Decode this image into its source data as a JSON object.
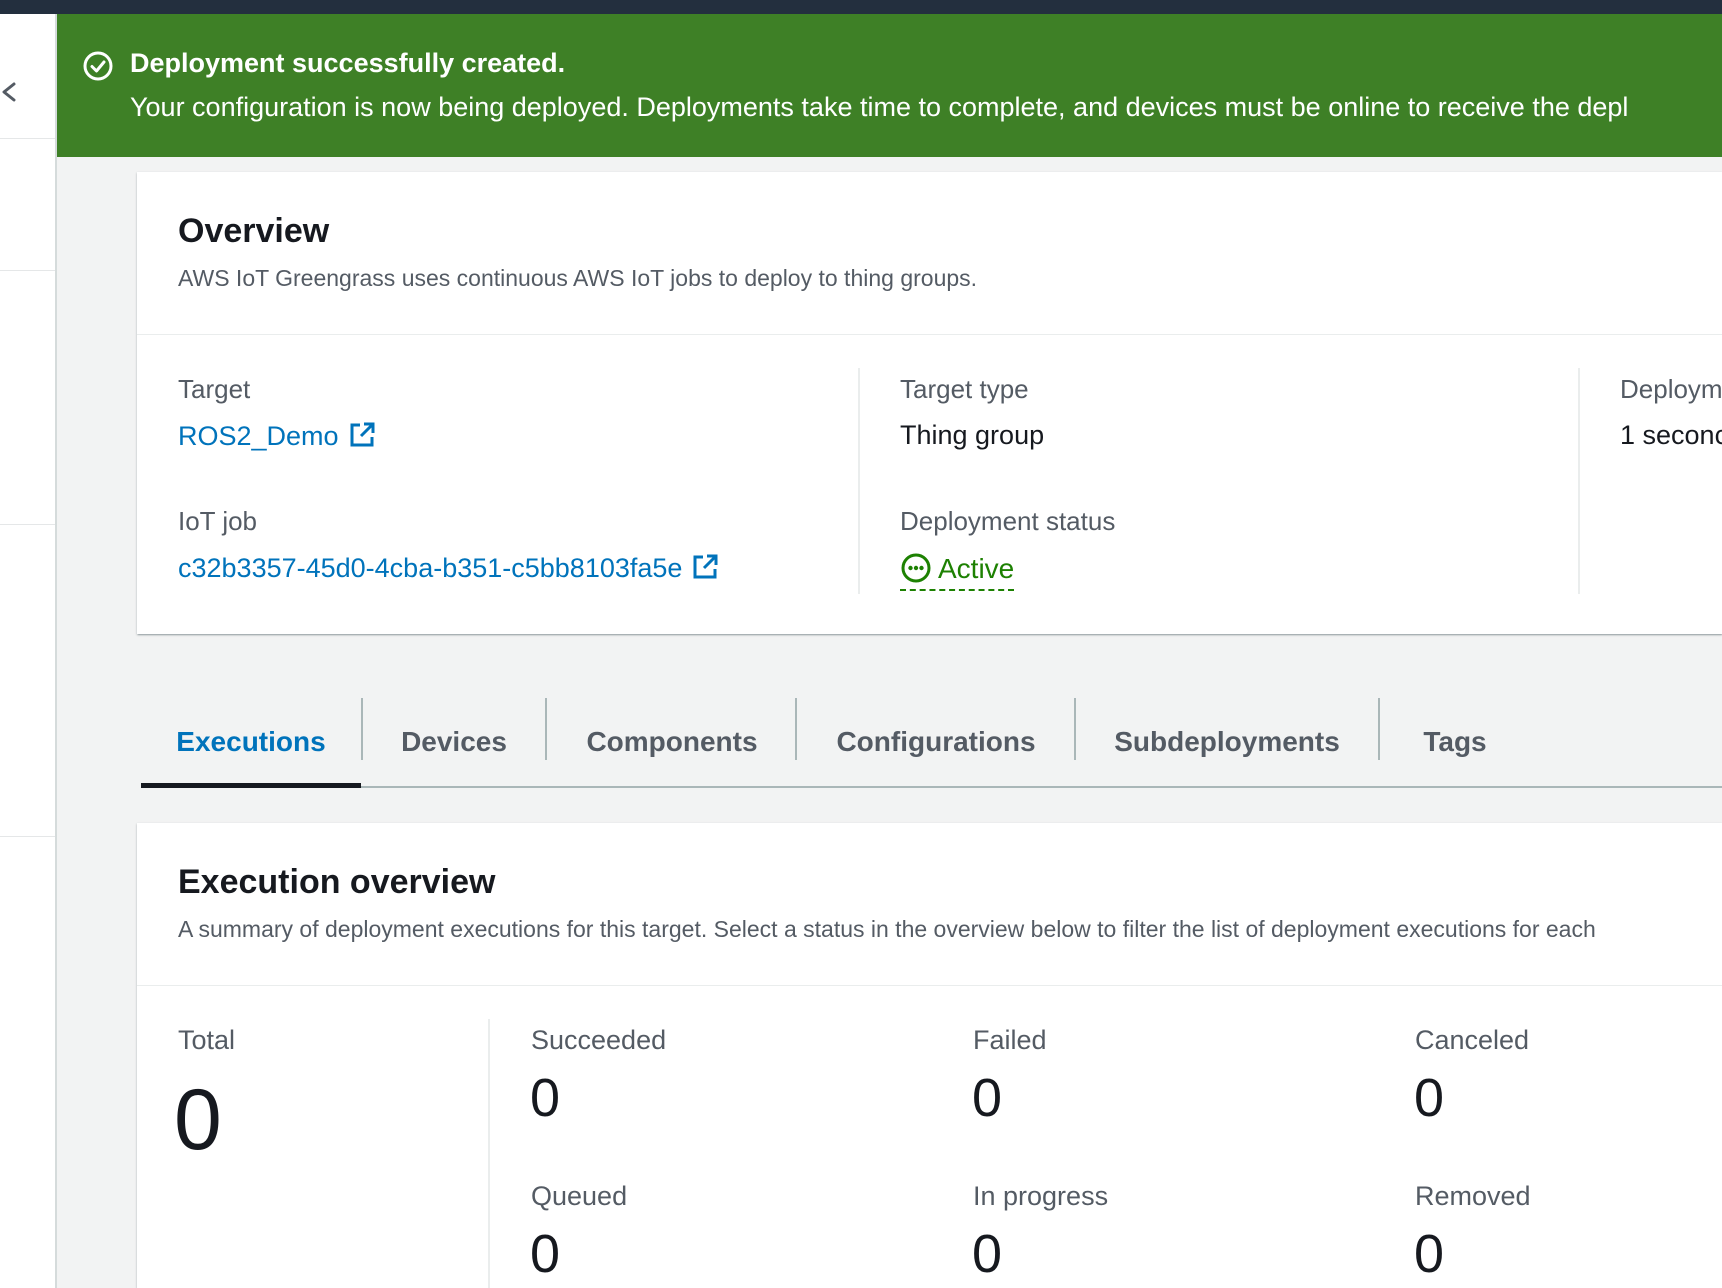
{
  "flash": {
    "title": "Deployment successfully created.",
    "message": "Your configuration is now being deployed. Deployments take time to complete, and devices must be online to receive the depl",
    "icon": "success-circle-icon",
    "color": "#3e8026"
  },
  "overview": {
    "title": "Overview",
    "description": "AWS IoT Greengrass uses continuous AWS IoT jobs to deploy to thing groups.",
    "target_label": "Target",
    "target_value": "ROS2_Demo",
    "iot_job_label": "IoT job",
    "iot_job_value": "c32b3357-45d0-4cba-b351-c5bb8103fa5e",
    "target_type_label": "Target type",
    "target_type_value": "Thing group",
    "deployment_status_label": "Deployment status",
    "deployment_status_value": "Active",
    "deployment_created_label": "Deploym",
    "deployment_created_value": "1 seconc"
  },
  "tabs": [
    {
      "label": "Executions",
      "active": true
    },
    {
      "label": "Devices",
      "active": false
    },
    {
      "label": "Components",
      "active": false
    },
    {
      "label": "Configurations",
      "active": false
    },
    {
      "label": "Subdeployments",
      "active": false
    },
    {
      "label": "Tags",
      "active": false
    }
  ],
  "execution_overview": {
    "title": "Execution overview",
    "description": "A summary of deployment executions for this target. Select a status in the overview below to filter the list of deployment executions for each",
    "total_label": "Total",
    "total_value": "0",
    "stats": {
      "succeeded": {
        "label": "Succeeded",
        "value": "0"
      },
      "failed": {
        "label": "Failed",
        "value": "0"
      },
      "canceled": {
        "label": "Canceled",
        "value": "0"
      },
      "queued": {
        "label": "Queued",
        "value": "0"
      },
      "in_progress": {
        "label": "In progress",
        "value": "0"
      },
      "removed": {
        "label": "Removed",
        "value": "0"
      }
    }
  },
  "colors": {
    "link": "#0073bb",
    "success": "#1d8102",
    "topbar": "#232f3e"
  }
}
